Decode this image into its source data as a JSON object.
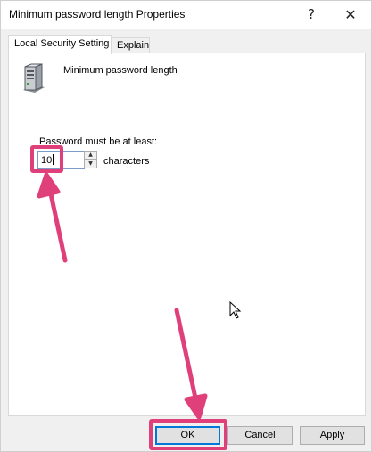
{
  "window": {
    "title": "Minimum password length Properties",
    "help_glyph": "?",
    "close_glyph": "✕"
  },
  "tabs": [
    {
      "label": "Local Security Setting",
      "selected": true
    },
    {
      "label": "Explain",
      "selected": false
    }
  ],
  "policy": {
    "icon": "server-icon",
    "name": "Minimum password length"
  },
  "password": {
    "label": "Password must be at least:",
    "value": "10",
    "unit": "characters"
  },
  "buttons": {
    "ok": "OK",
    "cancel": "Cancel",
    "apply": "Apply"
  },
  "colors": {
    "highlight": "#e0407a",
    "focus_border": "#0078d7"
  }
}
